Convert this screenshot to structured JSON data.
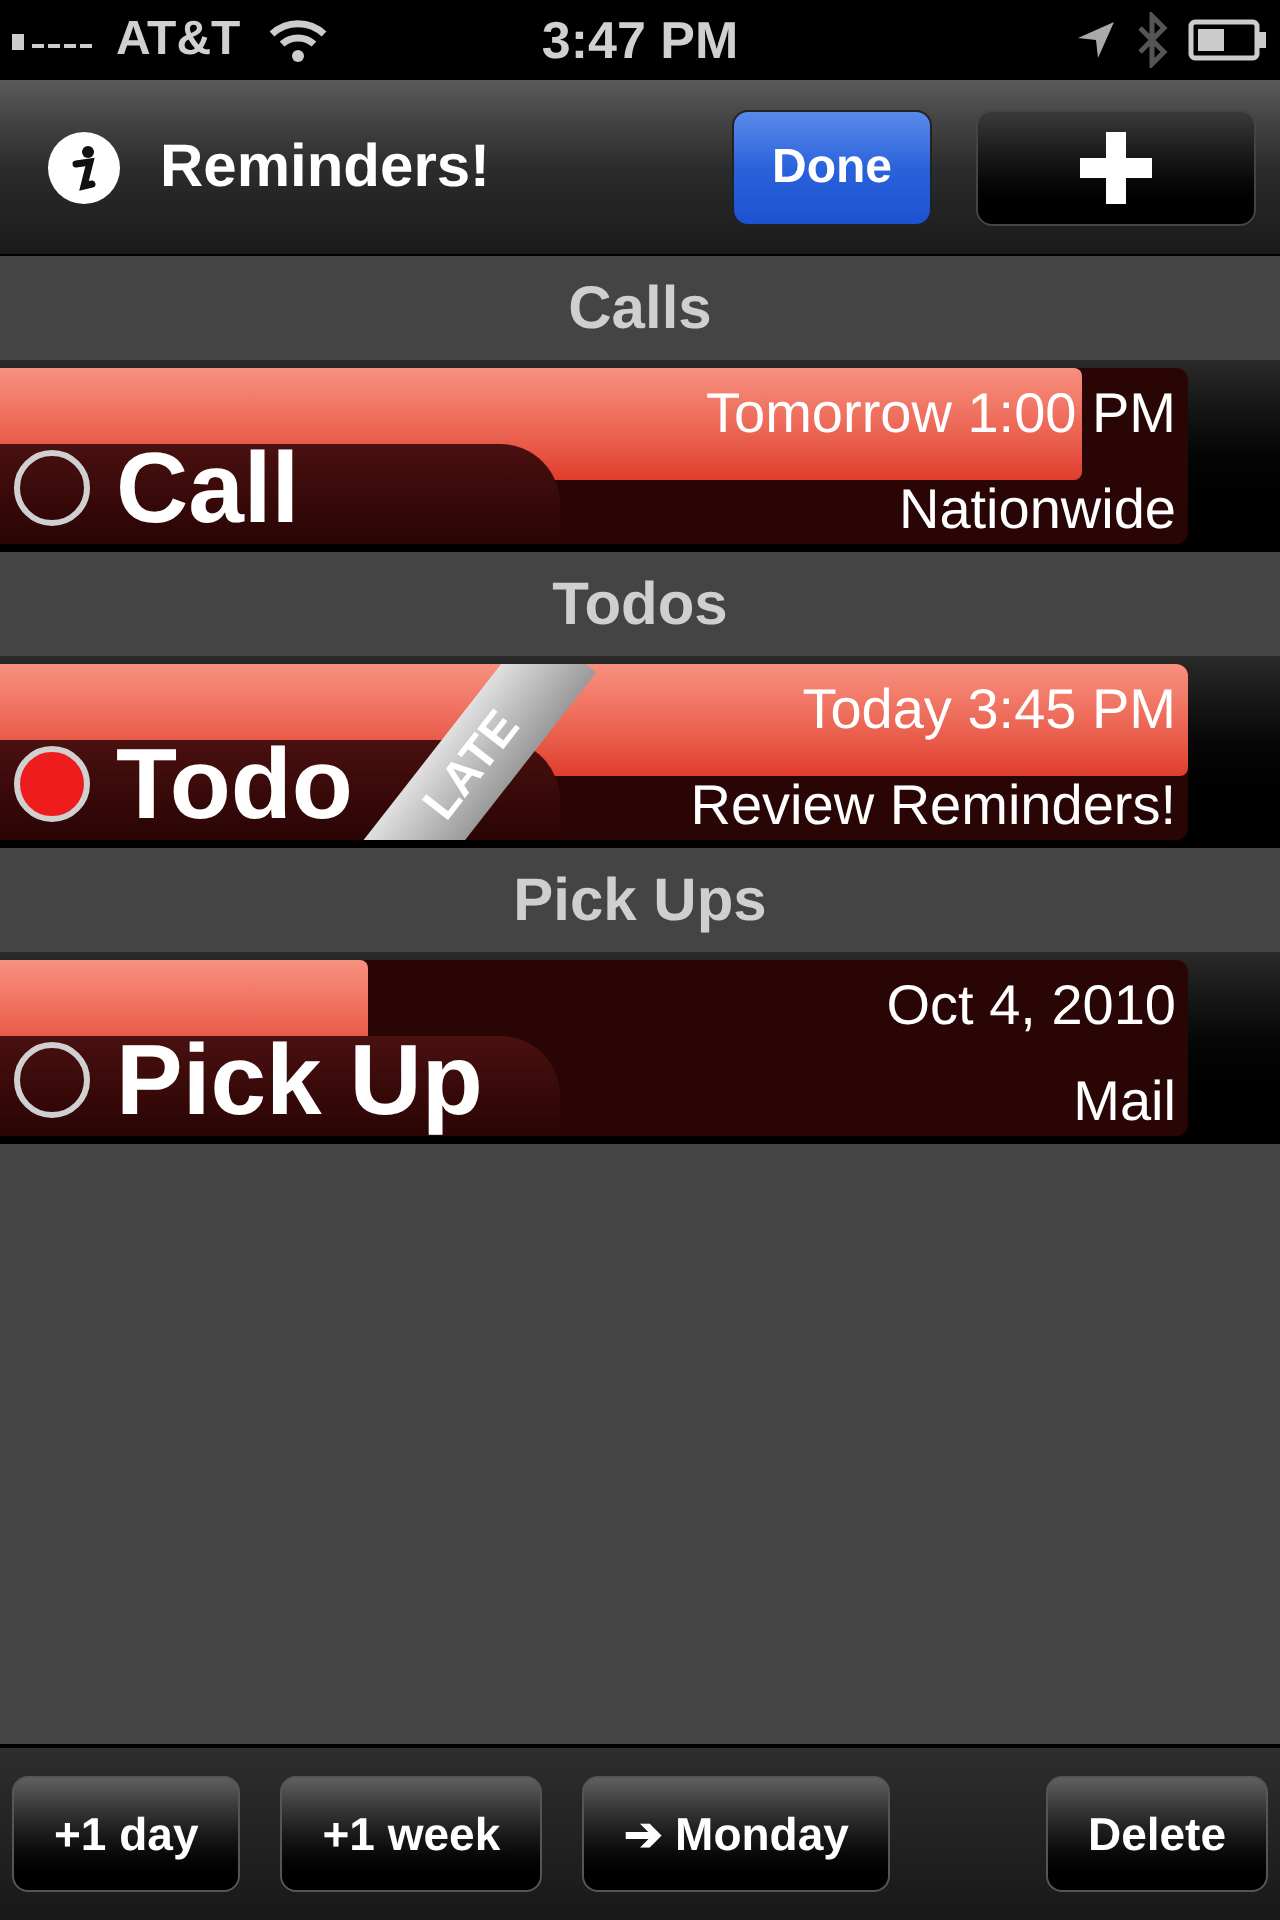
{
  "status_bar": {
    "carrier": "AT&T",
    "time": "3:47 PM"
  },
  "nav_bar": {
    "title": "Reminders!",
    "done_button": "Done"
  },
  "sections": [
    {
      "title": "Calls",
      "items": [
        {
          "title": "Call",
          "date": "Tomorrow 1:00 PM",
          "subtitle": "Nationwide",
          "level": 0.91,
          "late": false
        }
      ]
    },
    {
      "title": "Todos",
      "items": [
        {
          "title": "Todo",
          "date": "Today 3:45 PM",
          "subtitle": "Review Reminders!",
          "level": 1,
          "late": true,
          "badge": "LATE"
        }
      ]
    },
    {
      "title": "Pick Ups",
      "items": [
        {
          "title": "Pick Up",
          "date": "Oct 4, 2010",
          "subtitle": "Mail",
          "level": 0.31,
          "late": false
        }
      ]
    }
  ],
  "toolbar": {
    "buttons": [
      "+1 day",
      "+1 week",
      "➔ Monday",
      "Delete"
    ]
  }
}
